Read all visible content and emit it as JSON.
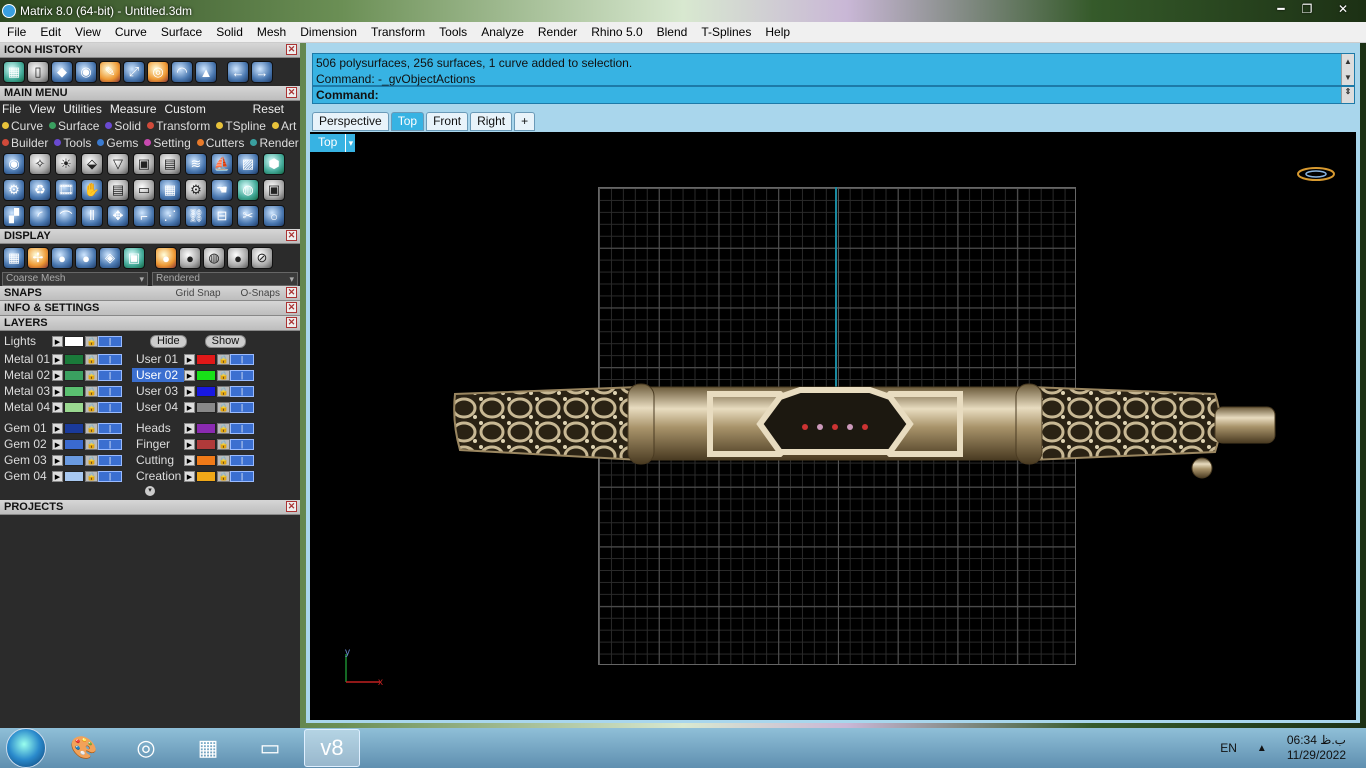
{
  "window": {
    "title": "Matrix 8.0 (64-bit) - Untitled.3dm"
  },
  "menubar": [
    "File",
    "Edit",
    "View",
    "Curve",
    "Surface",
    "Solid",
    "Mesh",
    "Dimension",
    "Transform",
    "Tools",
    "Analyze",
    "Render",
    "Rhino 5.0",
    "Blend",
    "T-Splines",
    "Help"
  ],
  "panel": {
    "icon_history": "ICON HISTORY",
    "main_menu": "MAIN MENU",
    "main_menu_items": [
      "File",
      "View",
      "Utilities",
      "Measure",
      "Custom"
    ],
    "reset": "Reset",
    "row1": [
      {
        "label": "Curve",
        "color": "#e8c23a"
      },
      {
        "label": "Surface",
        "color": "#3aa060"
      },
      {
        "label": "Solid",
        "color": "#6a4ad0"
      },
      {
        "label": "Transform",
        "color": "#d04a3a"
      },
      {
        "label": "TSpline",
        "color": "#e8c23a"
      },
      {
        "label": "Art",
        "color": "#e8c23a"
      }
    ],
    "row2": [
      {
        "label": "Builder",
        "color": "#d04a3a"
      },
      {
        "label": "Tools",
        "color": "#6a4ad0"
      },
      {
        "label": "Gems",
        "color": "#3a7ad0"
      },
      {
        "label": "Setting",
        "color": "#c84ab0"
      },
      {
        "label": "Cutters",
        "color": "#e87a2a"
      },
      {
        "label": "Render",
        "color": "#3aa0a0"
      }
    ],
    "display": "DISPLAY",
    "display_mode_left": "Coarse Mesh",
    "display_mode_right": "Rendered",
    "snaps": "SNAPS",
    "grid_snap": "Grid Snap",
    "o_snaps": "O-Snaps",
    "info_settings": "INFO & SETTINGS",
    "layers": "LAYERS",
    "lights": "Lights",
    "hide": "Hide",
    "show": "Show",
    "layers_left": [
      {
        "name": "Metal 01",
        "color": "#1a7a3a"
      },
      {
        "name": "Metal 02",
        "color": "#3aa060"
      },
      {
        "name": "Metal 03",
        "color": "#5ac070"
      },
      {
        "name": "Metal 04",
        "color": "#9ad890"
      },
      {
        "name": "Gem 01",
        "color": "#1a3a9a"
      },
      {
        "name": "Gem 02",
        "color": "#3a6ad0"
      },
      {
        "name": "Gem 03",
        "color": "#6a9ae0"
      },
      {
        "name": "Gem 04",
        "color": "#a8c8f0"
      }
    ],
    "layers_right": [
      {
        "name": "User 01",
        "color": "#e01818"
      },
      {
        "name": "User 02",
        "color": "#18e018"
      },
      {
        "name": "User 03",
        "color": "#1818e0"
      },
      {
        "name": "User 04",
        "color": "#888888"
      },
      {
        "name": "Heads",
        "color": "#8a2ab0"
      },
      {
        "name": "Finger",
        "color": "#b03a3a"
      },
      {
        "name": "Cutting",
        "color": "#f07a18"
      },
      {
        "name": "Creation",
        "color": "#f0a818"
      }
    ],
    "projects": "PROJECTS"
  },
  "command": {
    "history1": "506 polysurfaces, 256 surfaces, 1 curve added to selection.",
    "history2": "Command: -_gvObjectActions",
    "prompt": "Command:"
  },
  "tabs": [
    "Perspective",
    "Top",
    "Front",
    "Right"
  ],
  "active_tab": "Top",
  "viewport": {
    "label": "Top",
    "axis_x": "x",
    "axis_y": "y"
  },
  "taskbar": {
    "lang": "EN",
    "time": "06:34 ب.ظ",
    "date": "11/29/2022"
  }
}
